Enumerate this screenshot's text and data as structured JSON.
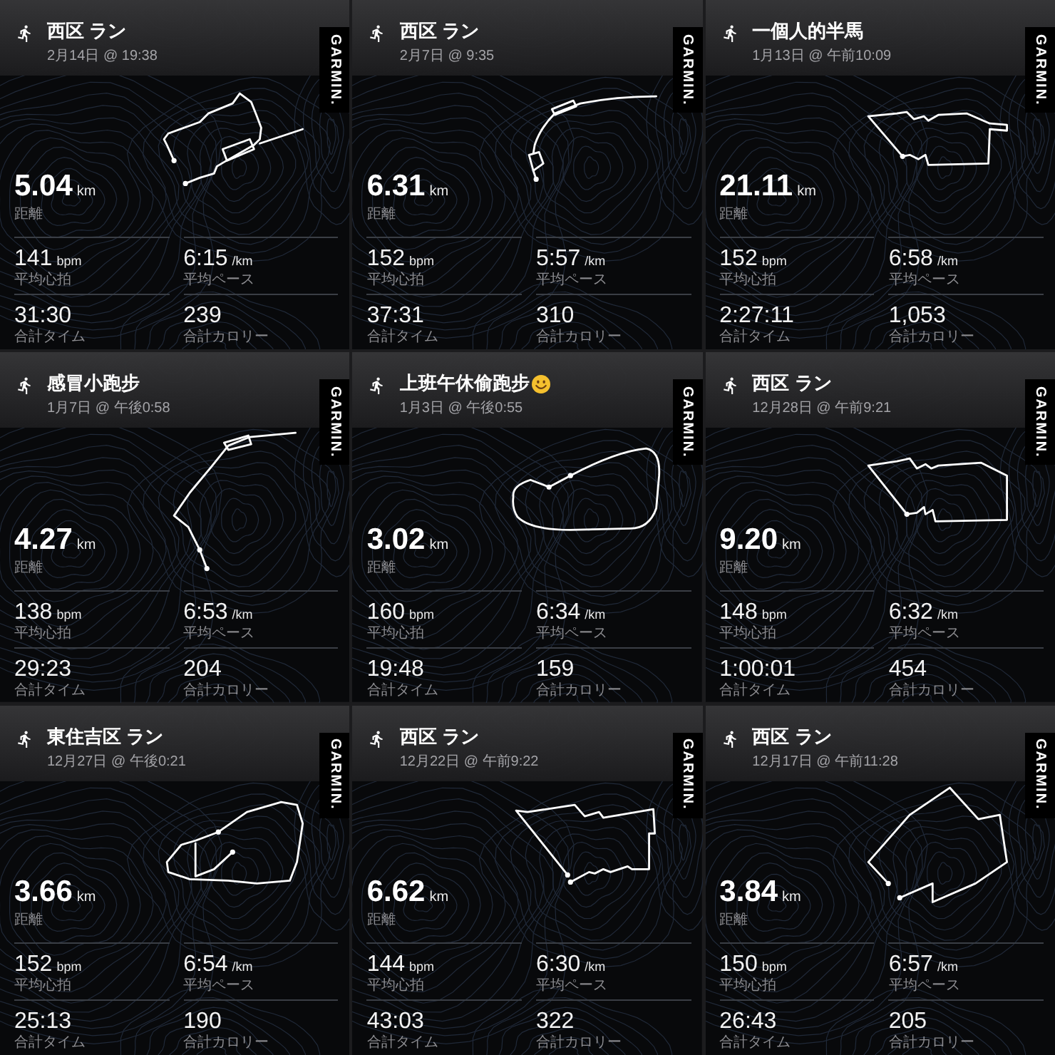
{
  "cards": [
    {
      "title": "西区 ラン",
      "emoji": false,
      "date": "2月14日 @ 19:38",
      "logo": "GARMIN.",
      "distance": {
        "value": "5.04",
        "unit": "km",
        "label": "距離"
      },
      "stats": [
        {
          "value": "141",
          "unit": "bpm",
          "label": "平均心拍"
        },
        {
          "value": "6:15",
          "unit": "/km",
          "label": "平均ペース"
        },
        {
          "value": "31:30",
          "label": "合計タイム"
        },
        {
          "value": "239",
          "label": "合計カロリー"
        }
      ]
    },
    {
      "title": "西区 ラン",
      "emoji": false,
      "date": "2月7日 @ 9:35",
      "logo": "GARMIN.",
      "distance": {
        "value": "6.31",
        "unit": "km",
        "label": "距離"
      },
      "stats": [
        {
          "value": "152",
          "unit": "bpm",
          "label": "平均心拍"
        },
        {
          "value": "5:57",
          "unit": "/km",
          "label": "平均ペース"
        },
        {
          "value": "37:31",
          "label": "合計タイム"
        },
        {
          "value": "310",
          "label": "合計カロリー"
        }
      ]
    },
    {
      "title": "一個人的半馬",
      "emoji": false,
      "date": "1月13日 @ 午前10:09",
      "logo": "GARMIN.",
      "distance": {
        "value": "21.11",
        "unit": "km",
        "label": "距離"
      },
      "stats": [
        {
          "value": "152",
          "unit": "bpm",
          "label": "平均心拍"
        },
        {
          "value": "6:58",
          "unit": "/km",
          "label": "平均ペース"
        },
        {
          "value": "2:27:11",
          "label": "合計タイム"
        },
        {
          "value": "1,053",
          "label": "合計カロリー"
        }
      ]
    },
    {
      "title": "感冒小跑步",
      "emoji": false,
      "date": "1月7日 @ 午後0:58",
      "logo": "GARMIN.",
      "distance": {
        "value": "4.27",
        "unit": "km",
        "label": "距離"
      },
      "stats": [
        {
          "value": "138",
          "unit": "bpm",
          "label": "平均心拍"
        },
        {
          "value": "6:53",
          "unit": "/km",
          "label": "平均ペース"
        },
        {
          "value": "29:23",
          "label": "合計タイム"
        },
        {
          "value": "204",
          "label": "合計カロリー"
        }
      ]
    },
    {
      "title": "上班午休偷跑步",
      "emoji": true,
      "date": "1月3日 @ 午後0:55",
      "logo": "GARMIN.",
      "distance": {
        "value": "3.02",
        "unit": "km",
        "label": "距離"
      },
      "stats": [
        {
          "value": "160",
          "unit": "bpm",
          "label": "平均心拍"
        },
        {
          "value": "6:34",
          "unit": "/km",
          "label": "平均ペース"
        },
        {
          "value": "19:48",
          "label": "合計タイム"
        },
        {
          "value": "159",
          "label": "合計カロリー"
        }
      ]
    },
    {
      "title": "西区 ラン",
      "emoji": false,
      "date": "12月28日 @ 午前9:21",
      "logo": "GARMIN.",
      "distance": {
        "value": "9.20",
        "unit": "km",
        "label": "距離"
      },
      "stats": [
        {
          "value": "148",
          "unit": "bpm",
          "label": "平均心拍"
        },
        {
          "value": "6:32",
          "unit": "/km",
          "label": "平均ペース"
        },
        {
          "value": "1:00:01",
          "label": "合計タイム"
        },
        {
          "value": "454",
          "label": "合計カロリー"
        }
      ]
    },
    {
      "title": "東住吉区 ラン",
      "emoji": false,
      "date": "12月27日 @ 午後0:21",
      "logo": "GARMIN.",
      "distance": {
        "value": "3.66",
        "unit": "km",
        "label": "距離"
      },
      "stats": [
        {
          "value": "152",
          "unit": "bpm",
          "label": "平均心拍"
        },
        {
          "value": "6:54",
          "unit": "/km",
          "label": "平均ペース"
        },
        {
          "value": "25:13",
          "label": "合計タイム"
        },
        {
          "value": "190",
          "label": "合計カロリー"
        }
      ]
    },
    {
      "title": "西区 ラン",
      "emoji": false,
      "date": "12月22日 @ 午前9:22",
      "logo": "GARMIN.",
      "distance": {
        "value": "6.62",
        "unit": "km",
        "label": "距離"
      },
      "stats": [
        {
          "value": "144",
          "unit": "bpm",
          "label": "平均心拍"
        },
        {
          "value": "6:30",
          "unit": "/km",
          "label": "平均ペース"
        },
        {
          "value": "43:03",
          "label": "合計タイム"
        },
        {
          "value": "322",
          "label": "合計カロリー"
        }
      ]
    },
    {
      "title": "西区 ラン",
      "emoji": false,
      "date": "12月17日 @ 午前11:28",
      "logo": "GARMIN.",
      "distance": {
        "value": "3.84",
        "unit": "km",
        "label": "距離"
      },
      "stats": [
        {
          "value": "150",
          "unit": "bpm",
          "label": "平均心拍"
        },
        {
          "value": "6:57",
          "unit": "/km",
          "label": "平均ペース"
        },
        {
          "value": "26:43",
          "label": "合計タイム"
        },
        {
          "value": "205",
          "label": "合計カロリー"
        }
      ]
    }
  ]
}
